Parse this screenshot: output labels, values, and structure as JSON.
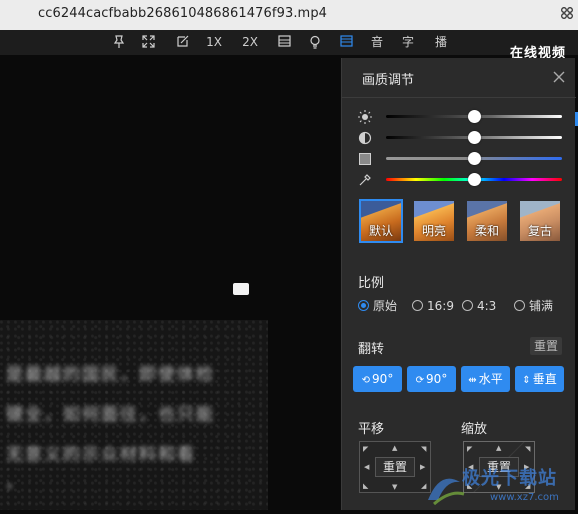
{
  "window": {
    "title": "cc6244cacfbabb268610486861476f93.mp4"
  },
  "toolbar": {
    "speed_1x": "1X",
    "speed_2x": "2X",
    "audio": "音",
    "subtitle": "字",
    "play": "播",
    "icons": [
      "pin-icon",
      "fullscreen-icon",
      "screenshot-icon",
      "layout-icon",
      "bulb-icon",
      "picture-icon"
    ],
    "online_label": "在线视频"
  },
  "video": {
    "lines": [
      "是最越的国民，即使体检",
      "键全，如何面往，也只能",
      "无意义的示众材料和看",
      "•"
    ]
  },
  "panel": {
    "title": "画质调节",
    "sliders": [
      {
        "name": "brightness",
        "icon": "sun-icon",
        "value": 0.5
      },
      {
        "name": "contrast",
        "icon": "contrast-icon",
        "value": 0.5
      },
      {
        "name": "saturation",
        "icon": "saturation-icon",
        "value": 0.5
      },
      {
        "name": "hue",
        "icon": "eyedropper-icon",
        "value": 0.5
      }
    ],
    "presets": [
      {
        "label": "默认",
        "selected": true
      },
      {
        "label": "明亮",
        "selected": false
      },
      {
        "label": "柔和",
        "selected": false
      },
      {
        "label": "复古",
        "selected": false
      }
    ],
    "ratio": {
      "title": "比例",
      "options": [
        {
          "label": "原始",
          "checked": true
        },
        {
          "label": "16:9",
          "checked": false
        },
        {
          "label": "4:3",
          "checked": false
        },
        {
          "label": "铺满",
          "checked": false
        }
      ]
    },
    "flip": {
      "title": "翻转",
      "reset": "重置",
      "buttons": [
        {
          "glyph": "⟲",
          "label": "90°"
        },
        {
          "glyph": "⟳",
          "label": "90°"
        },
        {
          "glyph": "⇹",
          "label": "水平"
        },
        {
          "glyph": "⇕",
          "label": "垂直"
        }
      ]
    },
    "move": {
      "title": "平移",
      "reset": "重置"
    },
    "zoom": {
      "title": "缩放",
      "reset": "重置"
    }
  },
  "watermark": {
    "text": "极光下载站",
    "url": "www.xz7.com"
  },
  "colors": {
    "accent": "#2f8bf0",
    "panel_bg": "#2b2b2b",
    "toolbar_bg": "#1d1d1d"
  }
}
